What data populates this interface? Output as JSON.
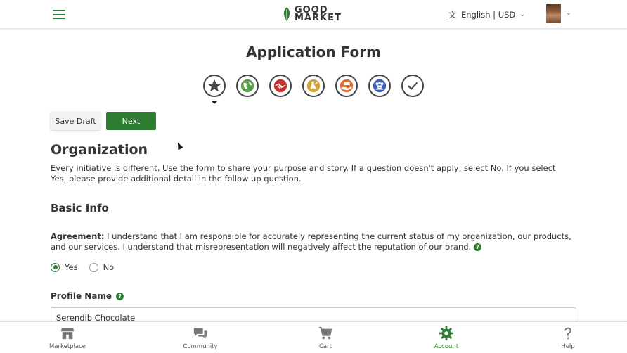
{
  "header": {
    "logo_line1": "GOOD",
    "logo_line2": "MARKET",
    "language": "English | USD"
  },
  "page": {
    "title": "Application Form"
  },
  "steps": [
    {
      "icon": "star-icon",
      "color": "#444444"
    },
    {
      "icon": "globe-icon",
      "color": "#5a9e4a"
    },
    {
      "icon": "handshake-icon",
      "color": "#c9302c"
    },
    {
      "icon": "worker-icon",
      "color": "#d4a23a"
    },
    {
      "icon": "hand-money-icon",
      "color": "#e06a2c"
    },
    {
      "icon": "people-icon",
      "color": "#3a5fb8"
    },
    {
      "icon": "check-icon",
      "color": "#444444"
    }
  ],
  "actions": {
    "save_draft": "Save Draft",
    "next": "Next"
  },
  "organization": {
    "heading": "Organization",
    "intro": "Every initiative is different. Use the form to share your purpose and story. If a question doesn't apply, select No. If you select Yes, please provide additional detail in the follow up question."
  },
  "basic_info": {
    "heading": "Basic Info",
    "agreement_label": "Agreement:",
    "agreement_text": " I understand that I am responsible for accurately representing the current status of my organization, our products, and our services. I understand that misrepresentation will negatively affect the reputation of our brand.",
    "options": {
      "yes": "Yes",
      "no": "No"
    },
    "selected": "yes",
    "profile_name_label": "Profile Name",
    "profile_name_value": "Serendib Chocolate"
  },
  "bottom_nav": {
    "marketplace": "Marketplace",
    "community": "Community",
    "cart": "Cart",
    "account": "Account",
    "help": "Help",
    "active": "account"
  },
  "colors": {
    "brand_green": "#2e7d32"
  }
}
